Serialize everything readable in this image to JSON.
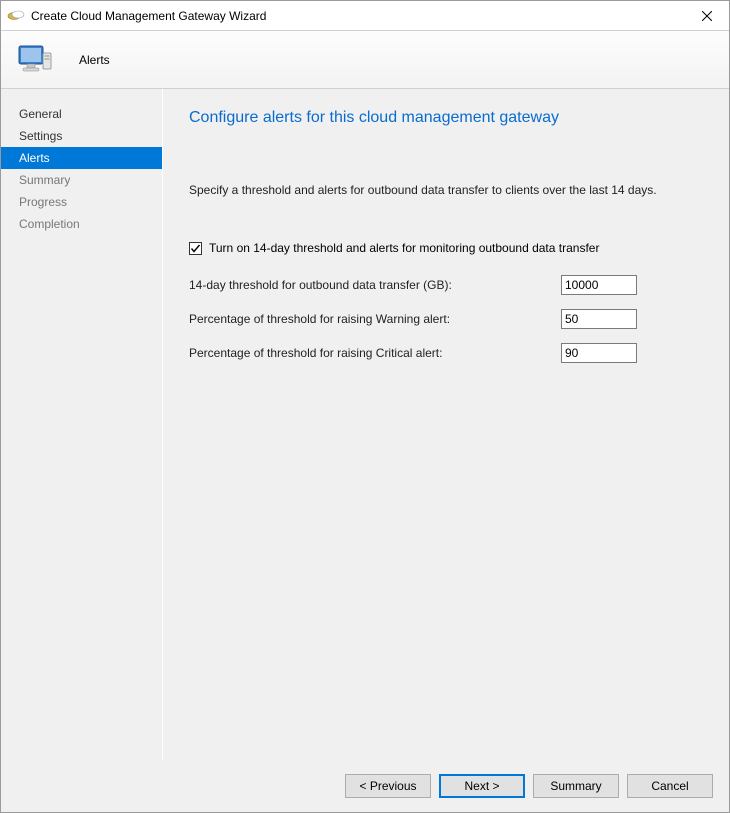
{
  "window": {
    "title": "Create Cloud Management Gateway Wizard"
  },
  "banner": {
    "title": "Alerts"
  },
  "sidebar": {
    "items": [
      {
        "label": "General",
        "state": "completed"
      },
      {
        "label": "Settings",
        "state": "completed"
      },
      {
        "label": "Alerts",
        "state": "active"
      },
      {
        "label": "Summary",
        "state": "pending"
      },
      {
        "label": "Progress",
        "state": "pending"
      },
      {
        "label": "Completion",
        "state": "pending"
      }
    ]
  },
  "page": {
    "heading": "Configure alerts for this cloud management gateway",
    "intro": "Specify a threshold and alerts for outbound data transfer to clients over the last 14 days.",
    "enable_label": "Turn on 14-day threshold and alerts for monitoring outbound data transfer",
    "enable_checked": true,
    "fields": {
      "threshold": {
        "label": "14-day threshold for outbound data transfer (GB):",
        "value": "10000"
      },
      "warning": {
        "label": "Percentage of threshold for raising Warning alert:",
        "value": "50"
      },
      "critical": {
        "label": "Percentage of threshold for raising Critical alert:",
        "value": "90"
      }
    }
  },
  "footer": {
    "previous": "< Previous",
    "next": "Next >",
    "summary": "Summary",
    "cancel": "Cancel"
  }
}
